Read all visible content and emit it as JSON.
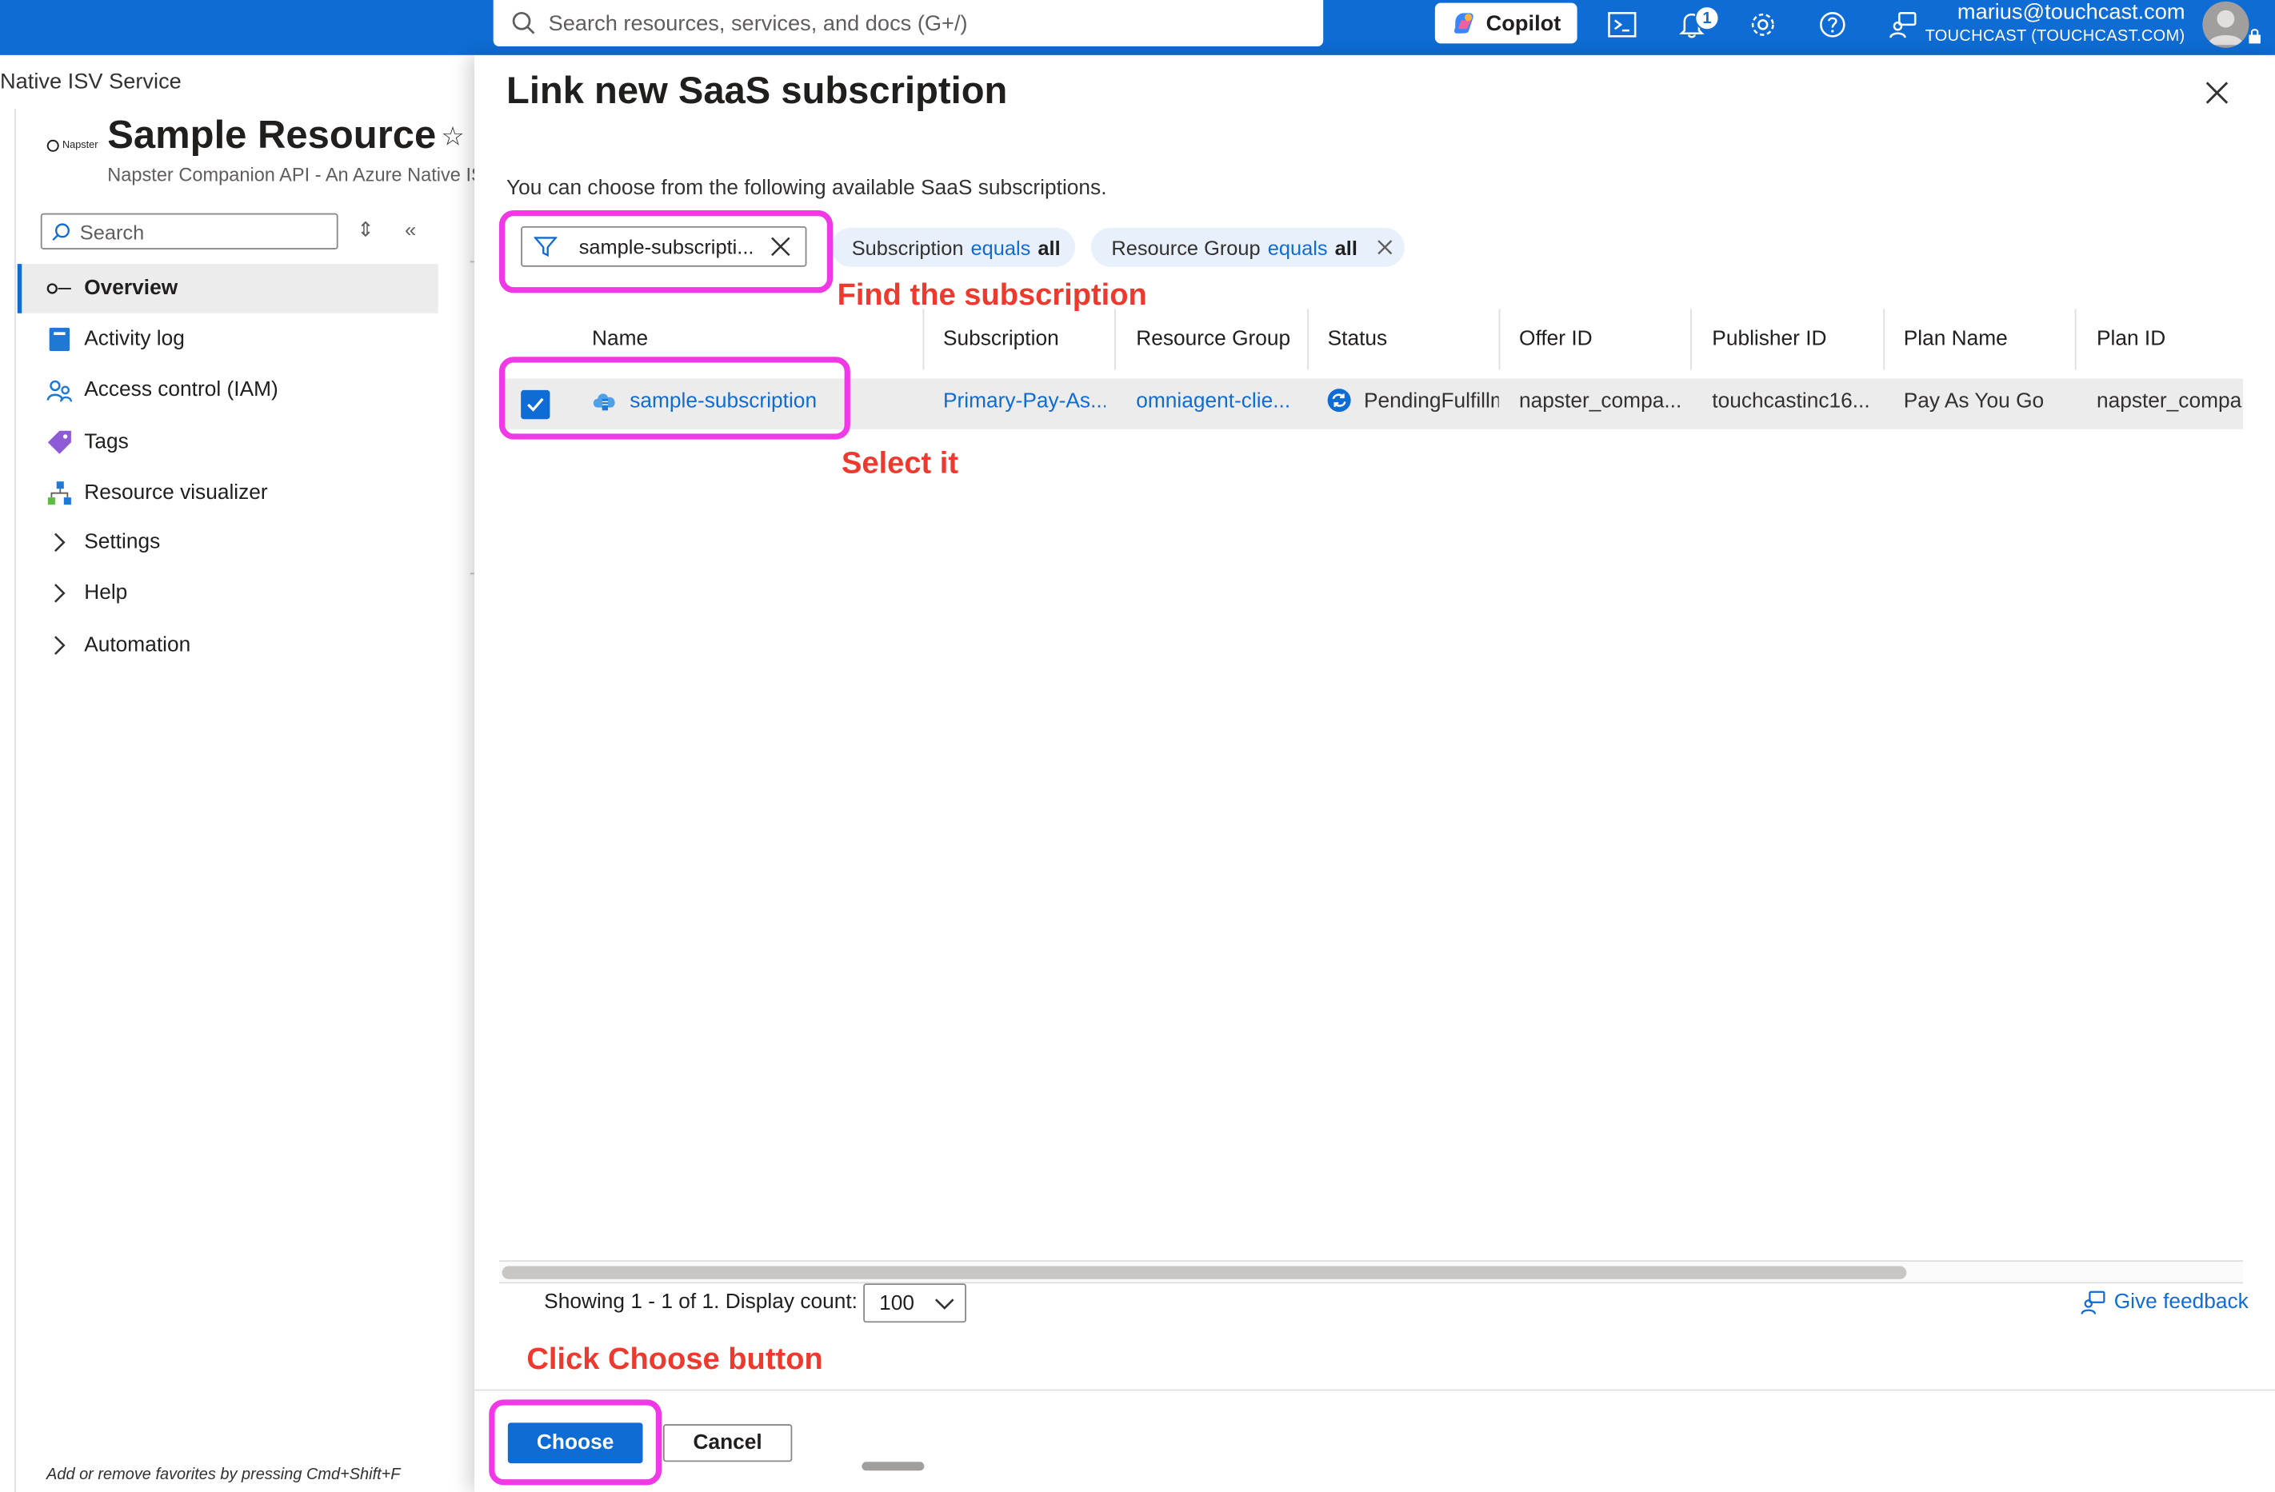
{
  "topbar": {
    "search_placeholder": "Search resources, services, and docs (G+/)",
    "copilot_label": "Copilot",
    "notification_count": "1",
    "account_email": "marius@touchcast.com",
    "account_tenant": "TOUCHCAST (TOUCHCAST.COM)"
  },
  "background_blade": {
    "breadcrumb": "Native ISV Service",
    "resource_title": "Sample Resource",
    "resource_subtitle": "Napster Companion API - An Azure Native ISV Service",
    "logo_text": "Napster",
    "nav_search_placeholder": "Search",
    "nav_items": [
      {
        "label": "Overview",
        "icon": "napster-logo-icon",
        "selected": true
      },
      {
        "label": "Activity log",
        "icon": "activity-log-icon",
        "selected": false
      },
      {
        "label": "Access control (IAM)",
        "icon": "people-icon",
        "selected": false
      },
      {
        "label": "Tags",
        "icon": "tag-icon",
        "selected": false
      },
      {
        "label": "Resource visualizer",
        "icon": "hierarchy-icon",
        "selected": false
      },
      {
        "label": "Settings",
        "icon": "chevron-right-icon",
        "selected": false
      },
      {
        "label": "Help",
        "icon": "chevron-right-icon",
        "selected": false
      },
      {
        "label": "Automation",
        "icon": "chevron-right-icon",
        "selected": false
      }
    ],
    "favorites_hint": "Add or remove favorites by pressing Cmd+Shift+F"
  },
  "panel": {
    "title": "Link new SaaS subscription",
    "description": "You can choose from the following available SaaS subscriptions.",
    "filter_value": "sample-subscripti...",
    "pills": [
      {
        "field": "Subscription",
        "op": "equals",
        "value": "all"
      },
      {
        "field": "Resource Group",
        "op": "equals",
        "value": "all"
      }
    ],
    "columns": [
      "Name",
      "Subscription",
      "Resource Group",
      "Status",
      "Offer ID",
      "Publisher ID",
      "Plan Name",
      "Plan ID"
    ],
    "rows": [
      {
        "name": "sample-subscription",
        "subscription": "Primary-Pay-As...",
        "resource_group": "omniagent-clie...",
        "status": "PendingFulfillm",
        "offer_id": "napster_compa...",
        "publisher_id": "touchcastinc16...",
        "plan_name": "Pay As You Go",
        "plan_id": "napster_compa...",
        "checked": true
      }
    ],
    "showing_text": "Showing 1 - 1 of 1. Display count:",
    "display_count": "100",
    "feedback_label": "Give feedback",
    "choose_label": "Choose",
    "cancel_label": "Cancel"
  },
  "annotations": {
    "find": "Find the subscription",
    "select": "Select it",
    "click": "Click Choose button",
    "highlight_color": "#f038e6",
    "text_color": "#ee3a2e"
  },
  "colors": {
    "azure_blue": "#0f6cd4",
    "selected_row": "#ececec"
  }
}
